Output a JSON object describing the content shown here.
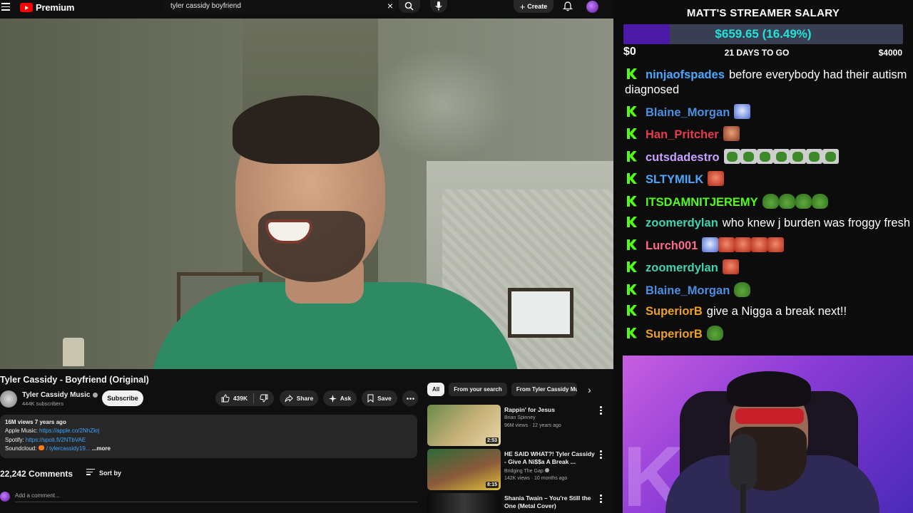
{
  "youtube": {
    "logo_text": "Premium",
    "search": {
      "query": "tyler cassidy boyfriend"
    },
    "create_label": "Create",
    "video": {
      "title": "Tyler Cassidy - Boyfriend (Original)",
      "channel": "Tyler Cassidy Music",
      "subscribers": "444K subscribers",
      "subscribe_label": "Subscribe",
      "likes": "439K",
      "share_label": "Share",
      "ask_label": "Ask",
      "save_label": "Save"
    },
    "description": {
      "views_age": "16M views  7 years ago",
      "apple_label": "Apple Music: ",
      "apple_link": "https://apple.co/2NhZkrj",
      "spotify_label": "Spotify: ",
      "spotify_link": "https://spoti.fi/2NTbVAE",
      "soundcloud_label": "Soundcloud: ",
      "soundcloud_link": "/ tylercassidy19...",
      "more_label": "...more"
    },
    "comments": {
      "count": "22,242 Comments",
      "sort_label": "Sort by",
      "add_placeholder": "Add a comment..."
    },
    "chips": [
      "All",
      "From your search",
      "From Tyler Cassidy Mu"
    ],
    "recommendations": [
      {
        "title": "Rappin' for Jesus",
        "channel": "Brian Spinney",
        "meta": "96M views · 12 years ago",
        "duration": "2:53",
        "thumb_colors": [
          "#6a8a4a",
          "#c9b27a"
        ]
      },
      {
        "title": "HE SAID WHAT?! Tyler Cassidy - Give A Ni$$a A Break ...",
        "channel": "Bridging The Gap",
        "meta": "142K views · 10 months ago",
        "duration": "8:15",
        "thumb_colors": [
          "#2d6b3a",
          "#e0c23a"
        ]
      },
      {
        "title": "Shania Twain – You're Still the One (Metal Cover)",
        "channel": "",
        "meta": "",
        "duration": "",
        "thumb_colors": [
          "#111111",
          "#444444"
        ]
      }
    ]
  },
  "overlay": {
    "salary_title": "MATT'S STREAMER SALARY",
    "salary_amount": "$659.65 (16.49%)",
    "salary_progress": 0.1649,
    "salary_min": "$0",
    "salary_days": "21 DAYS TO GO",
    "salary_max": "$4000",
    "chat": [
      {
        "user": "ninjaofspades",
        "color": "#4aa8ff",
        "text": "before everybody had their autism diagnosed",
        "emotes": []
      },
      {
        "user": "Blaine_Morgan",
        "color": "#4a8fe0",
        "text": "",
        "emotes": [
          "cat"
        ]
      },
      {
        "user": "Han_Pritcher",
        "color": "#e83a4a",
        "text": "",
        "emotes": [
          "face"
        ]
      },
      {
        "user": "cutsdadestro",
        "color": "#c9a0ff",
        "text": "",
        "emotes": [
          "frogbox",
          "frogbox",
          "frogbox",
          "frogbox",
          "frogbox",
          "frogbox",
          "frogbox"
        ]
      },
      {
        "user": "SLTYMILK",
        "color": "#4aa8ff",
        "text": "",
        "emotes": [
          "red"
        ]
      },
      {
        "user": "ITSDAMNITJEREMY",
        "color": "#53fc18",
        "text": "",
        "emotes": [
          "frog",
          "frog",
          "frog",
          "frog"
        ]
      },
      {
        "user": "zoomerdylan",
        "color": "#3fd3b0",
        "text": "who knew j burden was froggy fresh",
        "emotes": []
      },
      {
        "user": "Lurch001",
        "color": "#ff6a8a",
        "text": "",
        "emotes": [
          "cat",
          "red",
          "red",
          "red",
          "red"
        ]
      },
      {
        "user": "zoomerdylan",
        "color": "#3fd3b0",
        "text": "",
        "emotes": [
          "red"
        ]
      },
      {
        "user": "Blaine_Morgan",
        "color": "#4a8fe0",
        "text": "",
        "emotes": [
          "frog"
        ]
      },
      {
        "user": "SuperiorB",
        "color": "#f0a020",
        "text": "give a Nigga a break next!!",
        "emotes": []
      },
      {
        "user": "SuperiorB",
        "color": "#f0a020",
        "text": "",
        "emotes": [
          "frog"
        ]
      }
    ]
  }
}
